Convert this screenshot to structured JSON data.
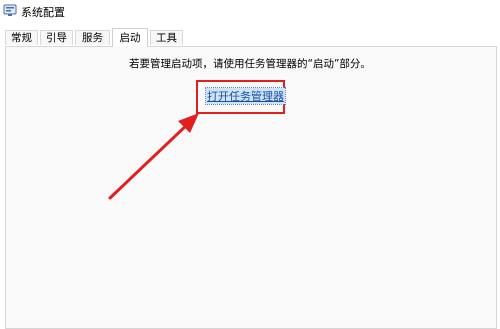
{
  "window": {
    "title": "系统配置",
    "icon": "msconfig-icon"
  },
  "tabs": [
    {
      "label": "常规",
      "active": false
    },
    {
      "label": "引导",
      "active": false
    },
    {
      "label": "服务",
      "active": false
    },
    {
      "label": "启动",
      "active": true
    },
    {
      "label": "工具",
      "active": false
    }
  ],
  "startup": {
    "instruction": "若要管理启动项，请使用任务管理器的“启动”部分。",
    "open_task_manager_link": "打开任务管理器"
  },
  "annotation": {
    "highlight_color": "#e02020",
    "arrow_color": "#e02020"
  }
}
